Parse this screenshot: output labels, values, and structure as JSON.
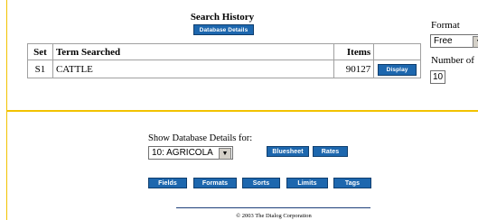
{
  "search_history": {
    "title": "Search History",
    "database_details_button": "Database Details",
    "columns": {
      "set": "Set",
      "term": "Term Searched",
      "items": "Items"
    },
    "rows": [
      {
        "set": "S1",
        "term": "CATTLE",
        "items": "90127",
        "action": "Display"
      }
    ]
  },
  "display_options": {
    "format_label": "Format",
    "format_value": "Free",
    "number_label": "Number of",
    "number_value": "10"
  },
  "database_details": {
    "label": "Show Database Details for:",
    "selected_database": "10: AGRICOLA",
    "bluesheet_button": "Bluesheet",
    "rates_button": "Rates",
    "detail_buttons": [
      "Fields",
      "Formats",
      "Sorts",
      "Limits",
      "Tags"
    ]
  },
  "footer": {
    "copyright": "© 2003 The Dialog Corporation"
  },
  "colors": {
    "button": "#1d67ae",
    "frame": "#f2c200"
  },
  "icons": {
    "dropdown": "chevron-down-icon"
  }
}
